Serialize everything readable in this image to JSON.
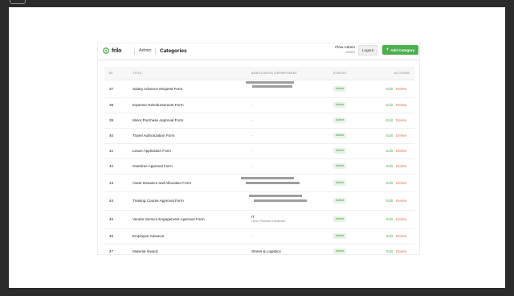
{
  "header": {
    "logo_text": "frilo",
    "nav_admin": "Admin",
    "page_title": "Categories",
    "user_name": "Flow Admin",
    "user_role": "ADMIN",
    "logout_label": "Logout",
    "add_label": "Add Category"
  },
  "table": {
    "columns": [
      "ID",
      "TITLE",
      "ASSOCIATED DEPARTMENT",
      "STATUS",
      "ACTIONS"
    ],
    "rows": [
      {
        "id": "37",
        "title": "Salary Advance Request Form",
        "dept": "",
        "dept_sub": "",
        "status": "Active",
        "edit": "Edit",
        "delete": "Delete"
      },
      {
        "id": "38",
        "title": "Expense Reimbursement Form",
        "dept": "-",
        "dept_sub": "",
        "status": "Active",
        "edit": "Edit",
        "delete": "Delete"
      },
      {
        "id": "39",
        "title": "Minor Purchase Approval Form",
        "dept": "-",
        "dept_sub": "",
        "status": "Active",
        "edit": "Edit",
        "delete": "Delete"
      },
      {
        "id": "40",
        "title": "Travel Authorization Form",
        "dept": "-",
        "dept_sub": "",
        "status": "Active",
        "edit": "Edit",
        "delete": "Delete"
      },
      {
        "id": "41",
        "title": "Leave Application Form",
        "dept": "-",
        "dept_sub": "",
        "status": "Active",
        "edit": "Edit",
        "delete": "Delete"
      },
      {
        "id": "42",
        "title": "Overtime Approval Form",
        "dept": "-",
        "dept_sub": "",
        "status": "Active",
        "edit": "Edit",
        "delete": "Delete"
      },
      {
        "id": "43",
        "title": "Asset Issuance and Allocation Form",
        "dept": "",
        "dept_sub": "",
        "status": "Active",
        "edit": "Edit",
        "delete": "Delete"
      },
      {
        "id": "44",
        "title": "Training Course Approval Form",
        "dept": "",
        "dept_sub": "",
        "status": "Active",
        "edit": "Edit",
        "delete": "Delete"
      },
      {
        "id": "45",
        "title": "Vendor Service Engagement Approval Form",
        "dept": "IT",
        "dept_sub": "Head: Prashant Dahibhate",
        "status": "Active",
        "edit": "Edit",
        "delete": "Delete"
      },
      {
        "id": "46",
        "title": "Employee Advance",
        "dept": "-",
        "dept_sub": "",
        "status": "Active",
        "edit": "Edit",
        "delete": "Delete"
      },
      {
        "id": "47",
        "title": "Material Inward",
        "dept": "Stores & Logistics",
        "dept_sub": "",
        "status": "Active",
        "edit": "Edit",
        "delete": "Delete"
      }
    ]
  },
  "colors": {
    "brand_green": "#4caf50",
    "delete_orange": "#e8744a",
    "badge_bg": "#e6f4e6"
  }
}
